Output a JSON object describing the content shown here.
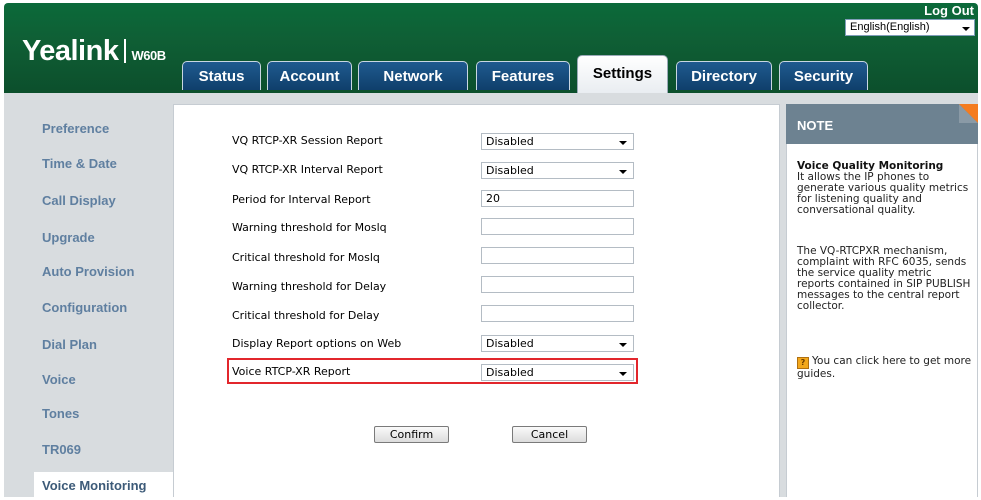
{
  "header": {
    "brand": "Yealink",
    "model": "W60B",
    "logout_label": "Log Out",
    "language_value": "English(English)"
  },
  "tabs": [
    {
      "label": "Status",
      "active": false
    },
    {
      "label": "Account",
      "active": false
    },
    {
      "label": "Network",
      "active": false
    },
    {
      "label": "Features",
      "active": false
    },
    {
      "label": "Settings",
      "active": true
    },
    {
      "label": "Directory",
      "active": false
    },
    {
      "label": "Security",
      "active": false
    }
  ],
  "sidebar": {
    "items": [
      {
        "label": "Preference"
      },
      {
        "label": "Time & Date"
      },
      {
        "label": "Call Display"
      },
      {
        "label": "Upgrade"
      },
      {
        "label": "Auto Provision"
      },
      {
        "label": "Configuration"
      },
      {
        "label": "Dial Plan"
      },
      {
        "label": "Voice"
      },
      {
        "label": "Tones"
      },
      {
        "label": "TR069"
      },
      {
        "label": "Voice Monitoring",
        "active": true
      }
    ]
  },
  "form": {
    "rows": [
      {
        "label": "VQ RTCP-XR Session Report",
        "type": "select",
        "value": "Disabled"
      },
      {
        "label": "VQ RTCP-XR Interval Report",
        "type": "select",
        "value": "Disabled"
      },
      {
        "label": "Period for Interval Report",
        "type": "text",
        "value": "20"
      },
      {
        "label": "Warning threshold for Moslq",
        "type": "text",
        "value": ""
      },
      {
        "label": "Critical threshold for Moslq",
        "type": "text",
        "value": ""
      },
      {
        "label": "Warning threshold for Delay",
        "type": "text",
        "value": ""
      },
      {
        "label": "Critical threshold for Delay",
        "type": "text",
        "value": ""
      },
      {
        "label": "Display Report options on Web",
        "type": "select",
        "value": "Disabled"
      },
      {
        "label": "Voice RTCP-XR Report",
        "type": "select",
        "value": "Disabled",
        "highlighted": true
      }
    ],
    "confirm_label": "Confirm",
    "cancel_label": "Cancel"
  },
  "note": {
    "title": "NOTE",
    "heading": "Voice Quality Monitoring",
    "para1": "It allows the IP phones to generate various quality metrics for listening quality and conversational quality.",
    "para2": "The VQ-RTCPXR mechanism, complaint with RFC 6035, sends the service quality metric reports contained in SIP PUBLISH messages to the central report collector.",
    "guide_text": "You can click here to get more guides."
  },
  "colors": {
    "header_green": "#0f5f35",
    "tab_blue": "#1f5a8f",
    "highlight_red": "#e2262c",
    "note_orange": "#f47c20",
    "sidebar_text": "#5f7fa0"
  }
}
